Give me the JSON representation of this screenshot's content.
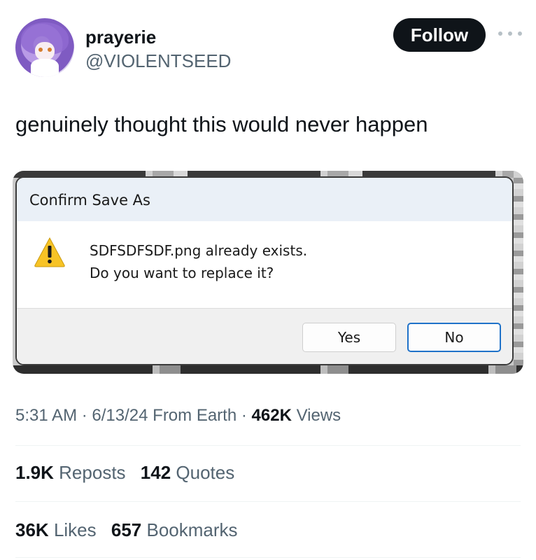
{
  "user": {
    "display_name": "prayerie",
    "handle": "@VIOLENTSEED",
    "follow_label": "Follow"
  },
  "tweet": {
    "text": "genuinely thought this would never happen"
  },
  "media": {
    "dialog": {
      "title": "Confirm Save As",
      "icon": "warning-icon",
      "message_line1": "SDFSDFSDF.png already exists.",
      "message_line2": "Do you want to replace it?",
      "yes_label": "Yes",
      "no_label": "No"
    }
  },
  "meta": {
    "time": "5:31 AM",
    "date": "6/13/24",
    "source": "From Earth",
    "views_count": "462K",
    "views_label": "Views",
    "separator": "·"
  },
  "stats": {
    "reposts_count": "1.9K",
    "reposts_label": "Reposts",
    "quotes_count": "142",
    "quotes_label": "Quotes",
    "likes_count": "36K",
    "likes_label": "Likes",
    "bookmarks_count": "657",
    "bookmarks_label": "Bookmarks"
  },
  "colors": {
    "text_primary": "#0f1419",
    "text_secondary": "#536471",
    "follow_bg": "#0f1419",
    "dialog_accent": "#1f72c9",
    "warning_yellow": "#f7c325"
  }
}
